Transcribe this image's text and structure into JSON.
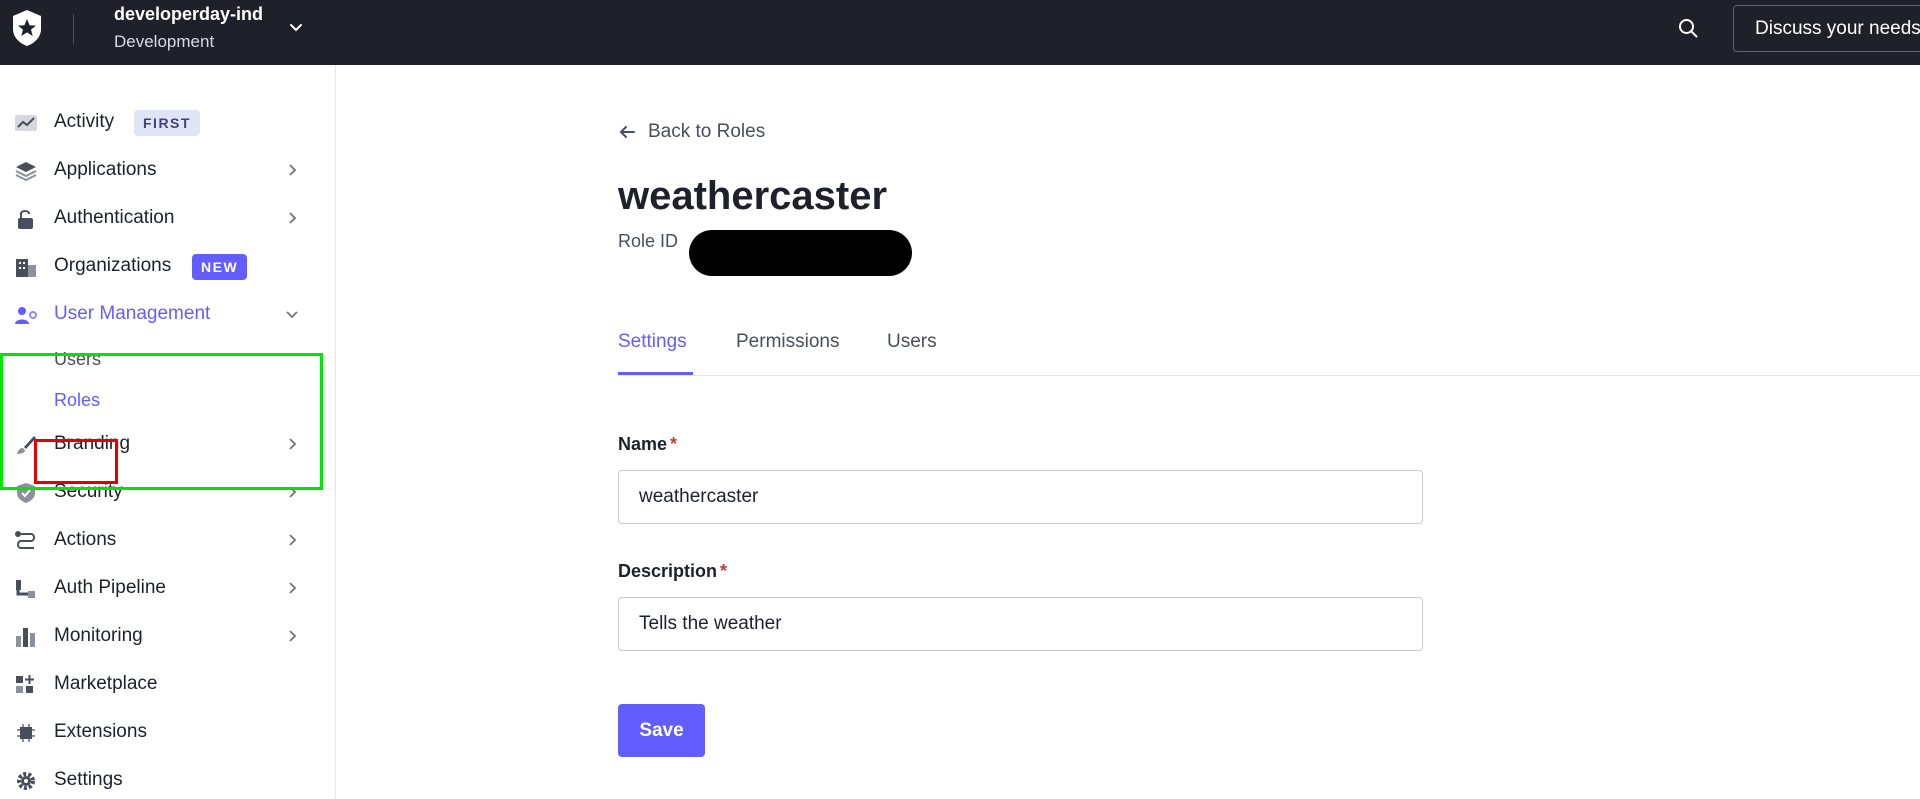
{
  "topbar": {
    "tenant_name": "developerday-ind",
    "tenant_env": "Development",
    "discuss_label": "Discuss your needs"
  },
  "sidebar": {
    "items": [
      {
        "label": "Activity",
        "badge": "FIRST",
        "icon": "activity-icon"
      },
      {
        "label": "Applications",
        "icon": "layers-icon"
      },
      {
        "label": "Authentication",
        "icon": "lock-icon"
      },
      {
        "label": "Organizations",
        "badge": "NEW",
        "icon": "building-icon"
      },
      {
        "label": "User Management",
        "icon": "users-gear-icon"
      },
      {
        "label": "Branding",
        "icon": "brush-icon"
      },
      {
        "label": "Security",
        "icon": "shield-icon"
      },
      {
        "label": "Actions",
        "icon": "flow-icon"
      },
      {
        "label": "Auth Pipeline",
        "icon": "pipeline-icon"
      },
      {
        "label": "Monitoring",
        "icon": "bar-chart-icon"
      },
      {
        "label": "Marketplace",
        "icon": "grid-plus-icon"
      },
      {
        "label": "Extensions",
        "icon": "chip-icon"
      },
      {
        "label": "Settings",
        "icon": "gear-icon"
      }
    ],
    "sub_items": [
      "Users",
      "Roles"
    ]
  },
  "main": {
    "back_label": "Back to Roles",
    "title": "weathercaster",
    "role_id_label": "Role ID",
    "tabs": [
      "Settings",
      "Permissions",
      "Users"
    ],
    "name_label": "Name",
    "name_value": "weathercaster",
    "description_label": "Description",
    "description_value": "Tells the weather",
    "required_mark": "*",
    "save_label": "Save"
  },
  "colors": {
    "accent": "#635dff",
    "topbar": "#1e212a",
    "annotation_green": "#00e600",
    "annotation_red": "#e60000"
  }
}
